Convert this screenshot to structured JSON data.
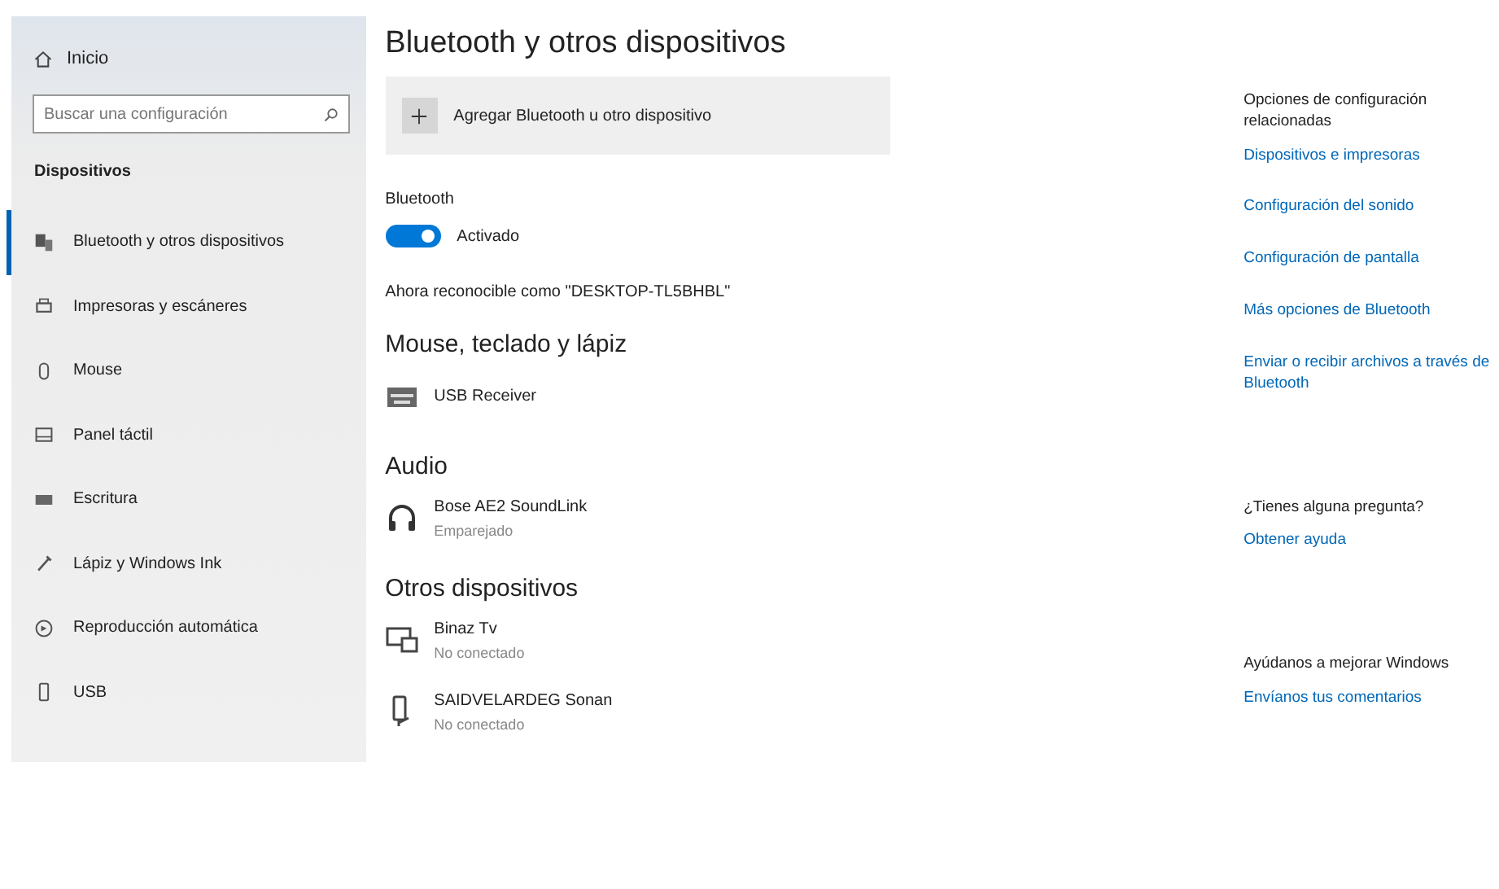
{
  "sidebar": {
    "home": "Inicio",
    "search": {
      "placeholder": "Buscar una configuración"
    },
    "section": "Dispositivos",
    "items": [
      {
        "label": "Bluetooth y otros dispositivos",
        "selected": true
      },
      {
        "label": "Impresoras y escáneres",
        "selected": false
      },
      {
        "label": "Mouse",
        "selected": false
      },
      {
        "label": "Panel táctil",
        "selected": false
      },
      {
        "label": "Escritura",
        "selected": false
      },
      {
        "label": "Lápiz y Windows Ink",
        "selected": false
      },
      {
        "label": "Reproducción automática",
        "selected": false
      },
      {
        "label": "USB",
        "selected": false
      }
    ]
  },
  "main": {
    "title": "Bluetooth y otros dispositivos",
    "add_button": "Agregar Bluetooth u otro dispositivo",
    "bluetooth": {
      "label": "Bluetooth",
      "on": true,
      "state": "Activado"
    },
    "discoverable": "Ahora reconocible como \"DESKTOP-TL5BHBL\"",
    "groups": [
      {
        "heading": "Mouse, teclado y lápiz",
        "devices": [
          {
            "name": "USB Receiver"
          }
        ]
      },
      {
        "heading": "Audio",
        "devices": [
          {
            "name": "Bose AE2 SoundLink",
            "status": "Emparejado"
          }
        ]
      },
      {
        "heading": "Otros dispositivos",
        "devices": [
          {
            "name": "Binaz Tv",
            "status": "No conectado"
          },
          {
            "name": "SAIDVELARDEG Sonan",
            "status": "No conectado"
          }
        ]
      }
    ]
  },
  "related": {
    "heading": "Opciones de configuración relacionadas",
    "links": [
      "Dispositivos e impresoras",
      "Configuración del sonido",
      "Configuración de pantalla",
      "Más opciones de Bluetooth",
      "Enviar o recibir archivos a través de Bluetooth"
    ],
    "help": [
      {
        "heading": "¿Tienes alguna pregunta?",
        "link": "Obtener ayuda"
      },
      {
        "heading": "Ayúdanos a mejorar Windows",
        "link": "Envíanos tus comentarios"
      }
    ]
  }
}
